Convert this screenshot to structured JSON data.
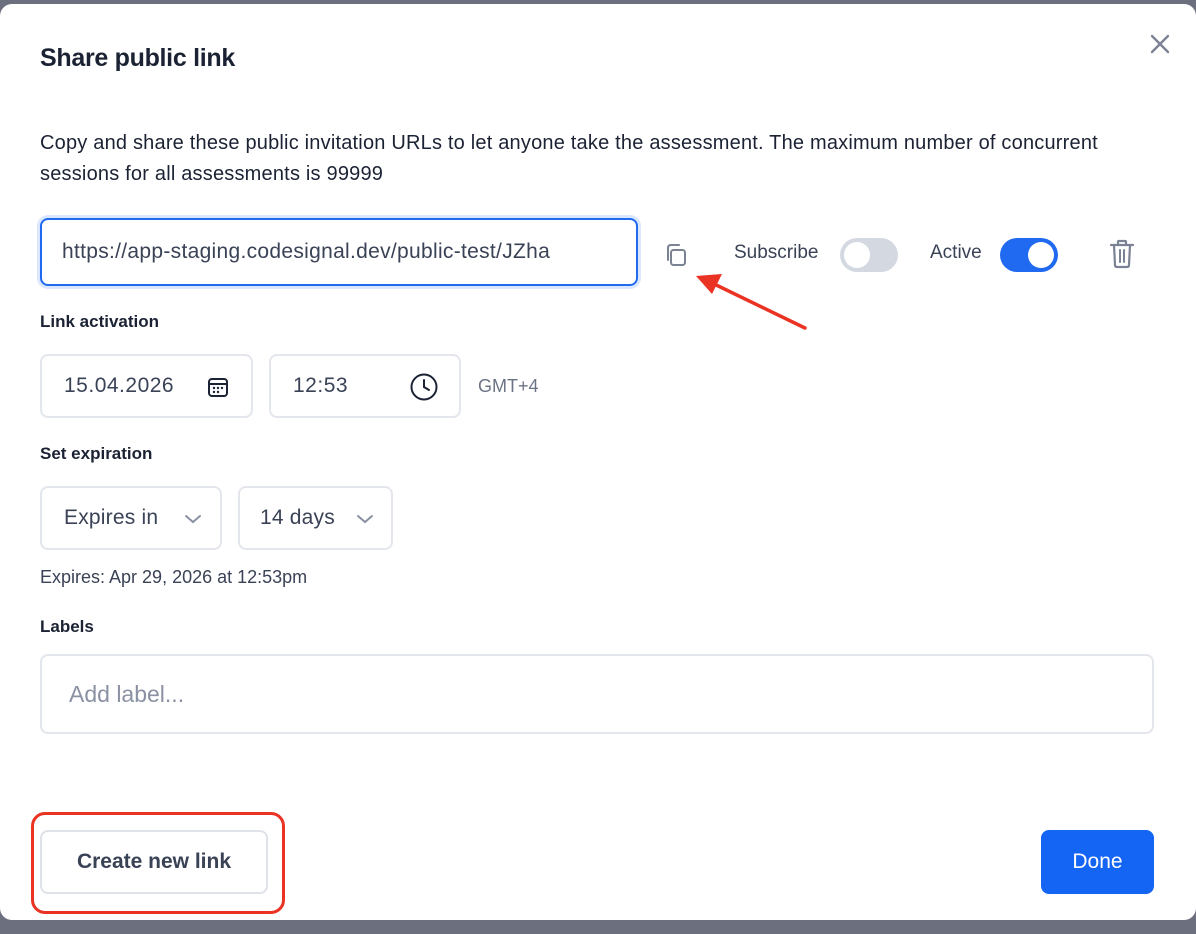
{
  "dialog": {
    "title": "Share public link",
    "description": "Copy and share these public invitation URLs to let anyone take the assessment. The maximum number of concurrent sessions for all assessments is 99999"
  },
  "link": {
    "url": "https://app-staging.codesignal.dev/public-test/JZha",
    "subscribe_label": "Subscribe",
    "subscribe_on": false,
    "active_label": "Active",
    "active_on": true
  },
  "activation": {
    "label": "Link activation",
    "date": "15.04.2026",
    "time": "12:53",
    "timezone": "GMT+4"
  },
  "expiration": {
    "label": "Set expiration",
    "mode": "Expires in",
    "duration": "14 days",
    "note": "Expires: Apr 29, 2026 at 12:53pm"
  },
  "labels": {
    "label": "Labels",
    "placeholder": "Add label..."
  },
  "footer": {
    "create_label": "Create new link",
    "done_label": "Done"
  },
  "colors": {
    "primary": "#1565f4",
    "annotation": "#ea3323"
  },
  "icons": {
    "close": "close-icon",
    "copy": "copy-icon",
    "delete": "trash-icon",
    "calendar": "calendar-icon",
    "clock": "clock-icon",
    "dropdown": "chevron-down-icon"
  }
}
